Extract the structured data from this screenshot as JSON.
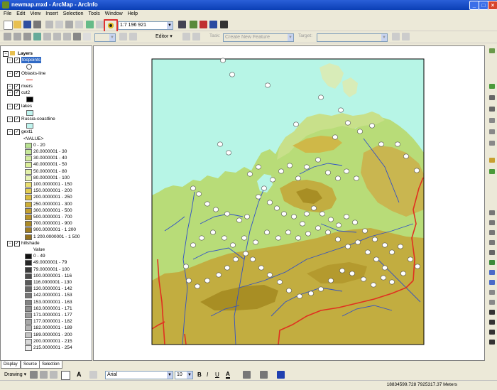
{
  "window": {
    "title": "newmap.mxd - ArcMap - ArcInfo"
  },
  "menu": [
    "File",
    "Edit",
    "View",
    "Insert",
    "Selection",
    "Tools",
    "Window",
    "Help"
  ],
  "toolbar": {
    "scale": "1:7 196 921"
  },
  "editor": {
    "label": "Editor",
    "task_label": "Task:",
    "task_value": "Create New Feature",
    "target_label": "Target:"
  },
  "toc": {
    "root": "Layers",
    "layers": [
      {
        "name": "tocpoints"
      },
      {
        "name": "Oblasts-line"
      },
      {
        "name": "rivers"
      },
      {
        "name": "cut2"
      },
      {
        "name": "lakes"
      },
      {
        "name": "Russia-coastline"
      },
      {
        "name": "gext1",
        "field": "<VALUE>",
        "classes": [
          "0 - 20",
          "20.0000001 - 30",
          "30.0000001 - 40",
          "40.0000001 - 50",
          "50.0000001 - 80",
          "80.0000001 - 100",
          "100.0000001 - 150",
          "150.0000001 - 200",
          "200.0000001 - 250",
          "250.0000001 - 300",
          "300.0000001 - 500",
          "500.0000001 - 700",
          "700.0000001 - 900",
          "900.0000001 - 1 200",
          "1 200.0000001 - 1 500"
        ]
      },
      {
        "name": "hillshade",
        "field": "Value",
        "classes": [
          "0 - 49",
          "49.0000001 - 79",
          "79.0000001 - 100",
          "100.0000001 - 116",
          "116.0000001 - 130",
          "130.0000001 - 142",
          "142.0000001 - 153",
          "153.0000001 - 163",
          "163.0000001 - 171",
          "171.0000001 - 177",
          "177.0000001 - 182",
          "182.0000001 - 189",
          "189.0000001 - 200",
          "200.0000001 - 215",
          "215.0000001 - 254"
        ]
      }
    ]
  },
  "tabs": [
    "Display",
    "Source",
    "Selection"
  ],
  "drawing": {
    "label": "Drawing",
    "font": "Arial",
    "size": "10",
    "bold": "B",
    "italic": "I",
    "underline": "U"
  },
  "status": {
    "coords": "18834599.728  7925317.37 Meters"
  },
  "colors": {
    "sea": "#b7f5e6",
    "lowland": "#b8dc78",
    "highland": "#c2ad40",
    "border": "#e03020",
    "river": "#3050c8",
    "highlight": "#e03030"
  },
  "gext_colors": [
    "#b9e292",
    "#c7e89a",
    "#d4ec9e",
    "#dcef9a",
    "#e2f0a8",
    "#e6f2b4",
    "#eadf70",
    "#e2cc50",
    "#d9bc3e",
    "#cdae36",
    "#c3a030",
    "#b89428",
    "#ac8a26",
    "#a07e24",
    "#947220"
  ],
  "hill_colors": [
    "#111111",
    "#262626",
    "#3a3a3a",
    "#4b4b4b",
    "#5a5a5a",
    "#686868",
    "#767676",
    "#838383",
    "#909090",
    "#9c9c9c",
    "#a8a8a8",
    "#b4b4b4",
    "#c4c4c4",
    "#d8d8d8",
    "#ececec"
  ]
}
